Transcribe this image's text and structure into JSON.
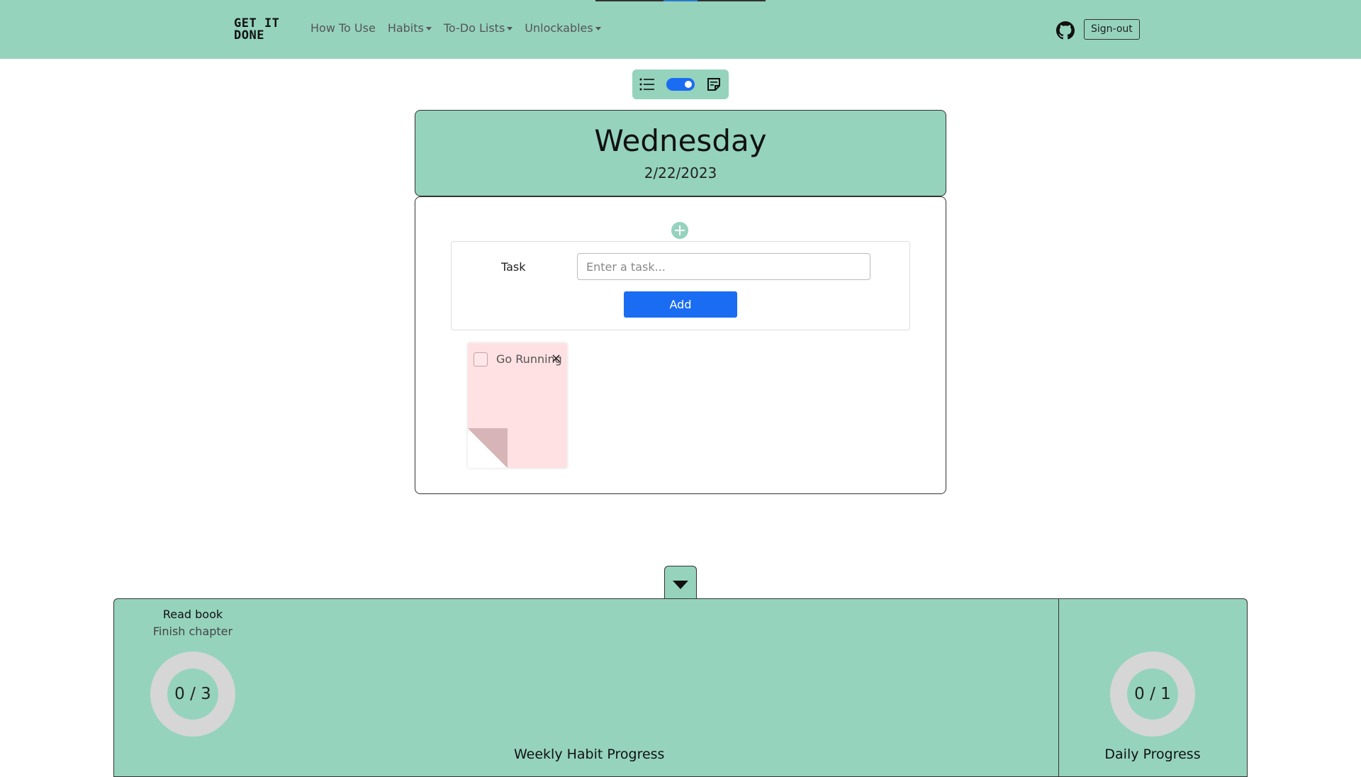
{
  "navbar": {
    "brand_line1": "GET IT",
    "brand_line2": "DONE",
    "links": [
      {
        "label": "How To Use",
        "dropdown": false
      },
      {
        "label": "Habits",
        "dropdown": true
      },
      {
        "label": "To-Do Lists",
        "dropdown": true
      },
      {
        "label": "Unlockables",
        "dropdown": true
      }
    ],
    "github_icon": "github-icon",
    "signout_label": "Sign-out"
  },
  "view_toggle": {
    "left_icon": "list-icon",
    "right_icon": "sticky-note-icon",
    "switch_on": true
  },
  "day": {
    "name": "Wednesday",
    "date": "2/22/2023"
  },
  "task_form": {
    "label": "Task",
    "placeholder": "Enter a task...",
    "add_label": "Add"
  },
  "notes": [
    {
      "text": "Go Running",
      "checked": false,
      "close": "×"
    }
  ],
  "progress": {
    "habit_name": "Read book",
    "habit_desc": "Finish chapter",
    "weekly_value": "0 / 3",
    "weekly_label": "Weekly Habit Progress",
    "daily_value": "0 / 1",
    "daily_label": "Daily Progress"
  },
  "colors": {
    "mint": "#95d3bd",
    "primary_blue": "#1a6df2",
    "sticky_pink": "#ffe1e3"
  }
}
